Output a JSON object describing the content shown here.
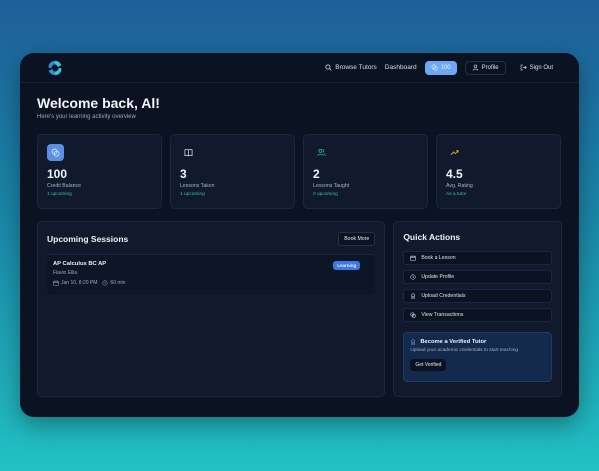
{
  "nav": {
    "logo_icon": "swirl-logo",
    "browse_label": "Browse Tutors",
    "dashboard_label": "Dashboard",
    "credits_label": "100",
    "profile_label": "Profile",
    "signout_label": "Sign Out"
  },
  "header": {
    "welcome": "Welcome back, Al!",
    "subtitle": "Here's your learning activity overview"
  },
  "stats": [
    {
      "icon": "coins-icon",
      "value": "100",
      "label": "Credit Balance",
      "sub": "1 upcoming"
    },
    {
      "icon": "book-icon",
      "value": "3",
      "label": "Lessons Taken",
      "sub": "1 upcoming"
    },
    {
      "icon": "users-icon",
      "value": "2",
      "label": "Lessons Taught",
      "sub": "0 upcoming"
    },
    {
      "icon": "trend-up-icon",
      "value": "4.5",
      "label": "Avg. Rating",
      "sub": "As a tutor"
    }
  ],
  "upcoming": {
    "title": "Upcoming Sessions",
    "book_more": "Book More",
    "sessions": [
      {
        "title": "AP Calculus BC AP",
        "tutor": "Flavio Ellia",
        "date": "Jan 10, 8:20 PM",
        "duration": "60 min",
        "badge": "Learning"
      }
    ]
  },
  "quick_actions": {
    "title": "Quick Actions",
    "items": [
      {
        "label": "Book a Lesson",
        "icon": "calendar-icon"
      },
      {
        "label": "Update Profile",
        "icon": "clock-icon"
      },
      {
        "label": "Upload Credentials",
        "icon": "award-icon"
      },
      {
        "label": "View Transactions",
        "icon": "coins-icon"
      }
    ],
    "verify": {
      "title": "Become a Verified Tutor",
      "desc": "Upload your academic credentials to start teaching",
      "button": "Get Verified"
    }
  },
  "colors": {
    "accent": "#6da8f5",
    "badge": "#3f78e0",
    "success_text": "#36c0a6",
    "rating_icon": "#f0a020"
  }
}
